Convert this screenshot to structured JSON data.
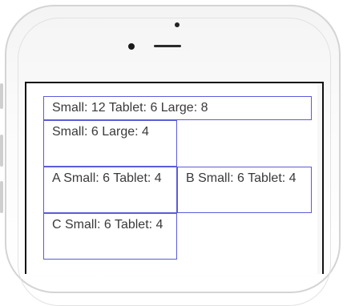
{
  "row1": {
    "full": "Small: 12 Tablet: 6 Large: 8"
  },
  "row2": {
    "left": "Small: 6 Large: 4"
  },
  "row3": {
    "a": "A Small: 6 Tablet: 4",
    "b": "B Small: 6 Tablet: 4"
  },
  "row4": {
    "c": "C Small: 6 Tablet: 4"
  }
}
